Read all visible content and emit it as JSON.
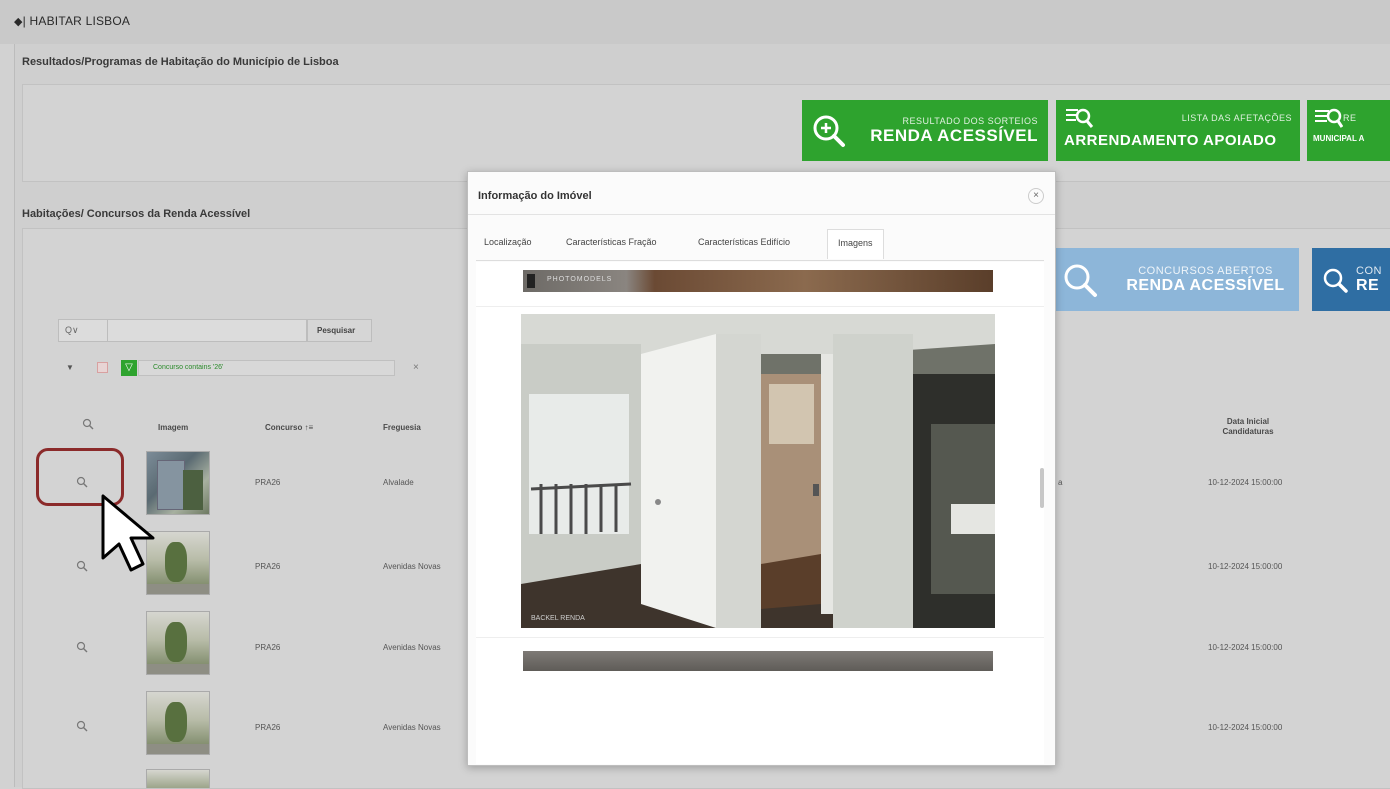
{
  "app": {
    "title": "| HABITAR LISBOA"
  },
  "section1": {
    "title": "Resultados/Programas de Habitação do Município de Lisboa"
  },
  "buttons": {
    "b1": {
      "small": "RESULTADO DOS SORTEIOS",
      "big": "RENDA ACESSÍVEL",
      "color": "#2ea32e"
    },
    "b2": {
      "small": "LISTA DAS AFETAÇÕES",
      "big": "ARRENDAMENTO APOIADO",
      "color": "#2ea32e"
    },
    "b3": {
      "small": "RE",
      "big": "MUNICIPAL A",
      "color": "#2ea32e"
    },
    "b4": {
      "small": "CONCURSOS ABERTOS",
      "big": "RENDA ACESSÍVEL",
      "color": "#8db6d9"
    },
    "b5": {
      "small": "CON",
      "big": "RE",
      "color": "#2f6ea3"
    }
  },
  "section2": {
    "title": "Habitações/ Concursos da Renda Acessível"
  },
  "search": {
    "prefix": "Q∨",
    "button": "Pesquisar"
  },
  "filter": {
    "label": "Concurso contains '26'",
    "close": "×"
  },
  "table": {
    "headers": {
      "image": "Imagem",
      "concurso": "Concurso ↑≡",
      "freguesia": "Freguesia",
      "data": "Data Inicial Candidaturas"
    },
    "rows": [
      {
        "concurso": "PRA26",
        "freguesia": "Alvalade",
        "extra": "a",
        "data": "10-12-2024 15:00:00"
      },
      {
        "concurso": "PRA26",
        "freguesia": "Avenidas Novas",
        "extra": "",
        "data": "10-12-2024 15:00:00"
      },
      {
        "concurso": "PRA26",
        "freguesia": "Avenidas Novas",
        "extra": "",
        "data": "10-12-2024 15:00:00"
      },
      {
        "concurso": "PRA26",
        "freguesia": "Avenidas Novas",
        "extra": "",
        "data": "10-12-2024 15:00:00"
      }
    ]
  },
  "modal": {
    "title": "Informação do Imóvel",
    "close": "×",
    "tabs": [
      "Localização",
      "Características Fração",
      "Características Edifício",
      "Imagens"
    ],
    "active_tab": "Imagens",
    "img1_caption": "PHOTOMODELS",
    "img2_caption": "BACKEL RENDA"
  },
  "colors": {
    "highlight": "#8b2a2a",
    "green": "#2ea32e"
  }
}
